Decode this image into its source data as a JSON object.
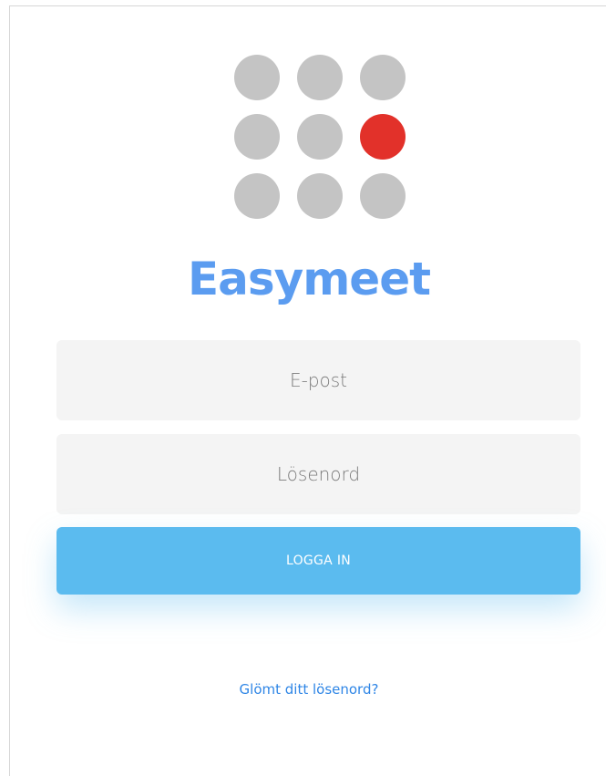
{
  "brand": {
    "name": "Easymeet",
    "logo_dot_color": "#c4c4c4",
    "logo_accent_color": "#e2312a",
    "title_color": "#5b9cf0"
  },
  "login_form": {
    "email_placeholder": "E-post",
    "password_placeholder": "Lösenord",
    "submit_label": "LOGGA IN",
    "submit_color": "#5bbbef",
    "forgot_password_label": "Glömt ditt lösenord?",
    "link_color": "#2f86e6"
  }
}
